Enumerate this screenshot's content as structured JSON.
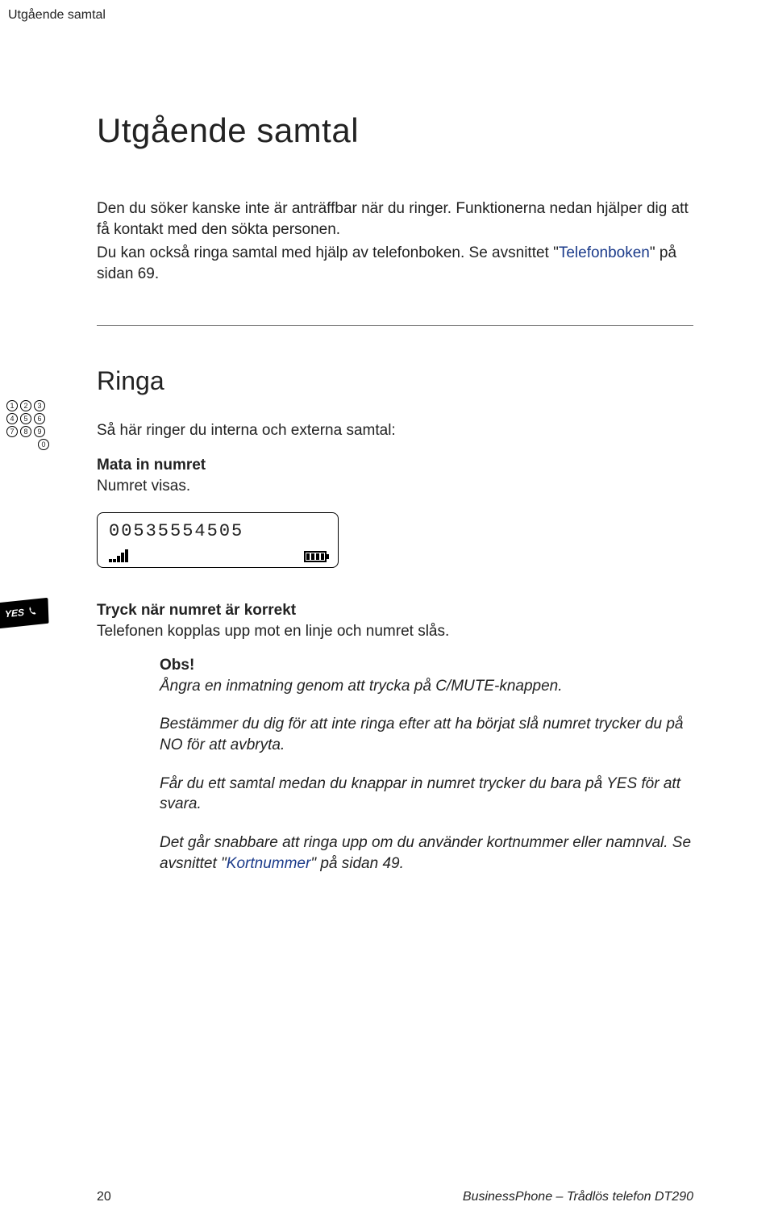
{
  "header": {
    "running_title": "Utgående samtal"
  },
  "main": {
    "title": "Utgående samtal",
    "intro_p1": "Den du söker kanske inte är anträffbar när du ringer. Funktionerna nedan hjälper dig att få kontakt med den sökta personen.",
    "intro_p2a": "Du kan också ringa samtal med hjälp av telefonboken. Se avsnittet \"",
    "intro_link1": "Telefonboken",
    "intro_p2b": "\" på sidan 69."
  },
  "ringa": {
    "heading": "Ringa",
    "instr1": "Så här ringer du interna och externa samtal:",
    "instr2_bold": "Mata in numret",
    "instr2_normal": "Numret visas.",
    "display_number": "00535554505",
    "instr3_bold": "Tryck när numret är korrekt",
    "instr3_normal": "Telefonen kopplas upp mot en linje och numret slås.",
    "note_title": "Obs!",
    "note1": "Ångra en inmatning genom att trycka på C/MUTE-knappen.",
    "note2": "Bestämmer du dig för att inte ringa efter att ha börjat slå numret trycker du på NO för att avbryta.",
    "note3": "Får du ett samtal medan du knappar in numret trycker du bara på YES för att svara.",
    "note4a": "Det går snabbare att ringa upp om du använder kortnummer eller namnval. Se avsnittet \"",
    "note4_link": "Kortnummer",
    "note4b": "\" på sidan 49."
  },
  "keypad": {
    "keys": [
      [
        "1",
        "2",
        "3"
      ],
      [
        "4",
        "5",
        "6"
      ],
      [
        "7",
        "8",
        "9"
      ],
      [
        "0"
      ]
    ]
  },
  "yes_badge": {
    "label": "YES"
  },
  "footer": {
    "page": "20",
    "product": "BusinessPhone – Trådlös telefon DT290"
  }
}
